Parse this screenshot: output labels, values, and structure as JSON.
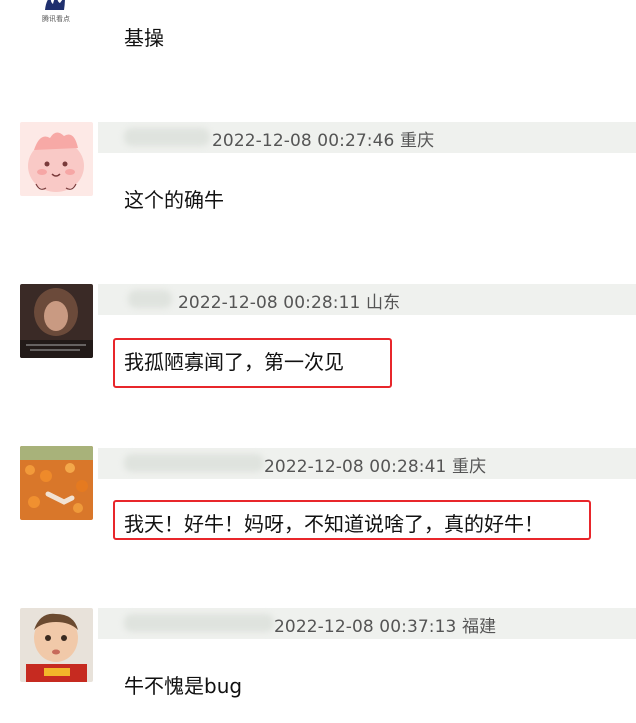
{
  "top_comment": {
    "logo_caption": "腾讯看点",
    "text": "基操"
  },
  "comments": [
    {
      "timestamp": "2022-12-08 00:27:46",
      "location": "重庆",
      "text": "这个的确牛"
    },
    {
      "timestamp": "2022-12-08 00:28:11",
      "location": "山东",
      "text": "我孤陋寡闻了，第一次见"
    },
    {
      "timestamp": "2022-12-08 00:28:41",
      "location": "重庆",
      "text": "我天！好牛！妈呀，不知道说啥了，真的好牛！"
    },
    {
      "timestamp": "2022-12-08 00:37:13",
      "location": "福建",
      "text": "牛不愧是bug"
    }
  ],
  "colors": {
    "highlight_border": "#e8262b",
    "meta_band": "#eff1ee"
  }
}
